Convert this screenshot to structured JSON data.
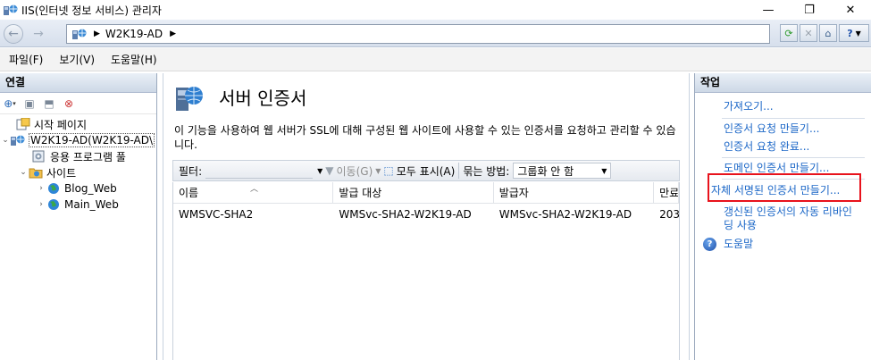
{
  "window": {
    "title": "IIS(인터넷 정보 서비스) 관리자",
    "controls": {
      "minimize": "—",
      "maximize": "❐",
      "close": "✕"
    }
  },
  "address": {
    "crumbs": [
      "W2K19-AD"
    ]
  },
  "menu": {
    "items": [
      "파일(F)",
      "보기(V)",
      "도움말(H)"
    ]
  },
  "connections": {
    "header": "연결",
    "tree": [
      {
        "label": "시작 페이지",
        "icon": "start-page-icon"
      },
      {
        "label": "W2K19-AD(W2K19-AD\\",
        "icon": "server-icon",
        "selected": true
      },
      {
        "label": "응용 프로그램 풀",
        "icon": "app-pool-icon"
      },
      {
        "label": "사이트",
        "icon": "sites-folder-icon"
      },
      {
        "label": "Blog_Web",
        "icon": "globe-icon"
      },
      {
        "label": "Main_Web",
        "icon": "globe-icon"
      }
    ]
  },
  "feature": {
    "title": "서버 인증서",
    "description": "이 기능을 사용하여 웹 서버가 SSL에 대해 구성된 웹 사이트에 사용할 수 있는 인증서를 요청하고 관리할 수 있습니다.",
    "filter_label": "필터:",
    "go_label": "이동(G)",
    "show_all_label": "모두 표시(A)",
    "group_by_label": "묶는 방법:",
    "group_by_value": "그룹화 안 함",
    "columns": [
      "이름",
      "발급 대상",
      "발급자",
      "만료"
    ],
    "rows": [
      [
        "WMSVC-SHA2",
        "WMSvc-SHA2-W2K19-AD",
        "WMSvc-SHA2-W2K19-AD",
        "203"
      ]
    ]
  },
  "actions": {
    "header": "작업",
    "items": [
      "가져오기...",
      "인증서 요청 만들기...",
      "인증서 요청 완료...",
      "도메인 인증서 만들기...",
      "자체 서명된 인증서 만들기...",
      "갱신된 인증서의 자동 리바인",
      "딩 사용",
      "도움말"
    ],
    "highlight_color": "#e8131c",
    "link_color": "#1a66c7"
  }
}
